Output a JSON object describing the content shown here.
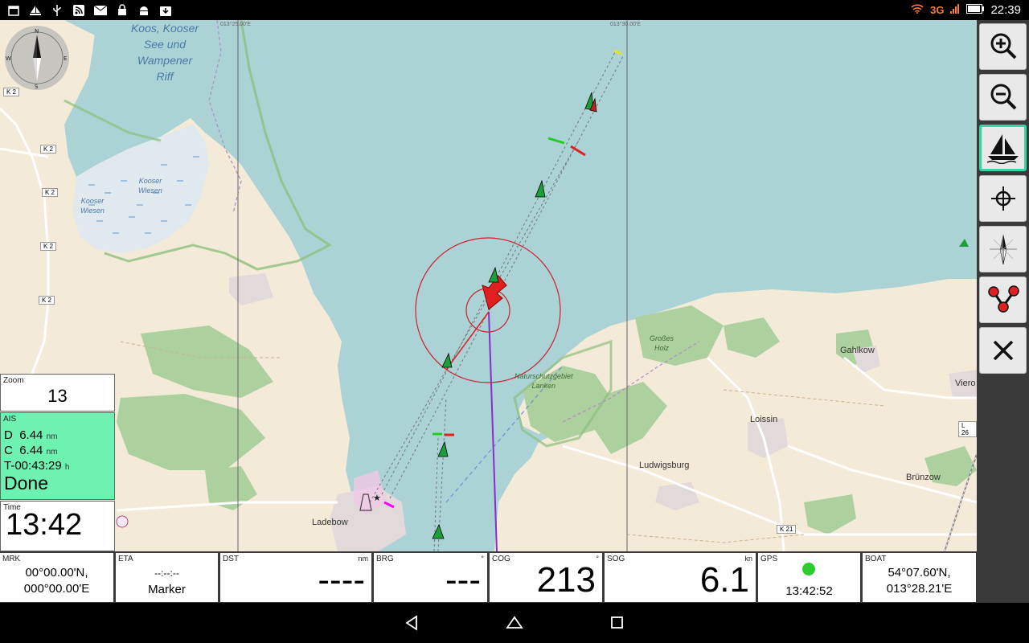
{
  "status_bar": {
    "left_icons": [
      "calendar-icon",
      "boat-icon",
      "usb-icon",
      "rss-icon",
      "mail-icon",
      "lock-icon",
      "android-icon",
      "download-icon"
    ],
    "network": "3G",
    "time": "22:39"
  },
  "map": {
    "coord_top_1": "013°25.00'E",
    "coord_top_2": "013°30.00'E",
    "places": {
      "koos": "Koos, Kooser",
      "see_und": "See und",
      "wampener": "Wampener",
      "riff": "Riff",
      "kooser": "Kooser",
      "wiesen": "Wiesen",
      "grosses": "Großes",
      "holz": "Holz",
      "naturschutzgebiet": "Naturschutzgebiet",
      "lanken": "Lanken",
      "gahlkow": "Gahlkow",
      "vierow": "Viero",
      "loissin": "Loissin",
      "ludwigsburg": "Ludwigsburg",
      "brunzow": "Brünzow",
      "ladebow": "Ladebow"
    },
    "roads": [
      "K 2",
      "K 2",
      "K 2",
      "K 2",
      "K 2",
      "K 21",
      "L 26"
    ]
  },
  "toolbar": {
    "buttons": [
      "zoom-in",
      "zoom-out",
      "boat-mode",
      "center-position",
      "north-up",
      "route",
      "close"
    ]
  },
  "panels": {
    "zoom": {
      "label": "Zoom",
      "value": "13"
    },
    "ais": {
      "label": "AIS",
      "d_label": "D",
      "d_value": "6.44",
      "d_unit": "nm",
      "c_label": "C",
      "c_value": "6.44",
      "c_unit": "nm",
      "t_label": "T",
      "t_value": "-00:43:29",
      "t_unit": "h",
      "status": "Done"
    },
    "time": {
      "label": "Time",
      "value": "13:42"
    }
  },
  "bottom": {
    "mrk": {
      "label": "MRK",
      "line1": "00°00.00'N,",
      "line2": "000°00.00'E"
    },
    "eta": {
      "label": "ETA",
      "line1": "--:--:--",
      "line2": "Marker"
    },
    "dst": {
      "label": "DST",
      "unit": "nm",
      "value": "----"
    },
    "brg": {
      "label": "BRG",
      "unit": "°",
      "value": "---"
    },
    "cog": {
      "label": "COG",
      "unit": "°",
      "value": "213"
    },
    "sog": {
      "label": "SOG",
      "unit": "kn",
      "value": "6.1"
    },
    "gps": {
      "label": "GPS",
      "value": "13:42:52",
      "status_color": "#2ecc2e"
    },
    "boat": {
      "label": "BOAT",
      "line1": "54°07.60'N,",
      "line2": "013°28.21'E"
    }
  },
  "navbar": {
    "buttons": [
      "back",
      "home",
      "recents"
    ]
  }
}
